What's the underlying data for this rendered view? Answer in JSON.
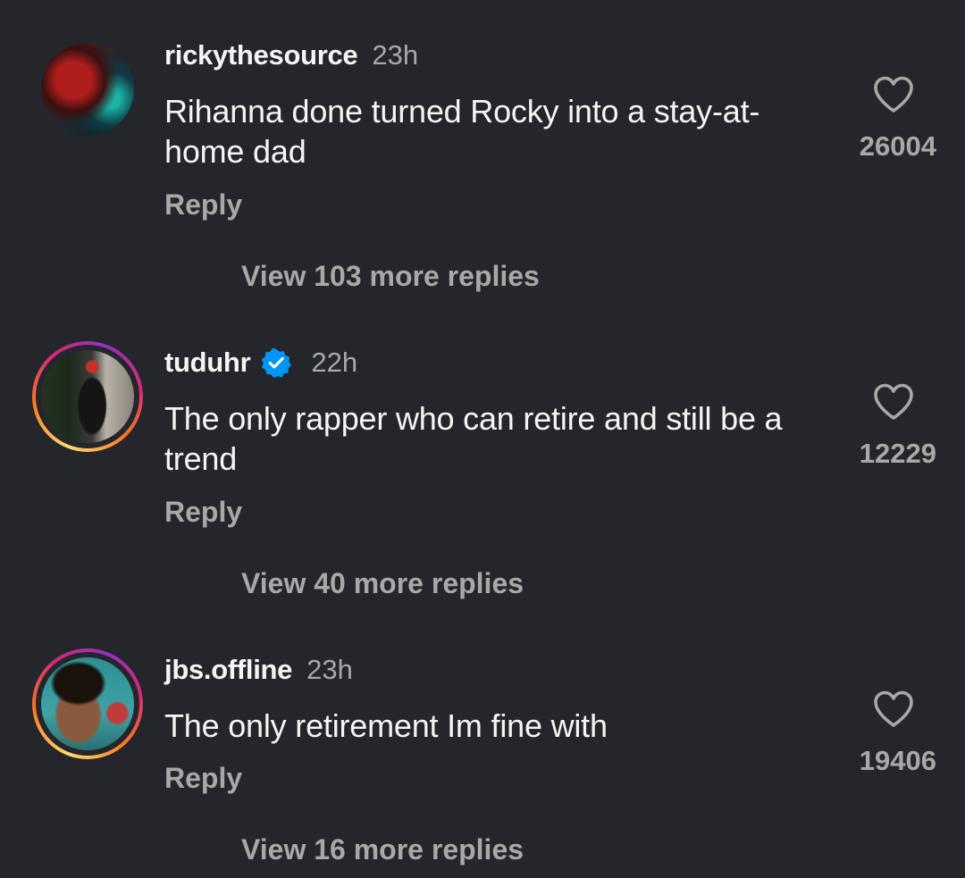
{
  "comments": [
    {
      "username": "rickythesource",
      "time": "23h",
      "verified": false,
      "text": "Rihanna done turned Rocky into a stay-at-home dad",
      "reply_label": "Reply",
      "likes": "26004",
      "view_more": "View 103 more replies"
    },
    {
      "username": "tuduhr",
      "time": "22h",
      "verified": true,
      "text": "The only rapper who can retire and still be a trend",
      "reply_label": "Reply",
      "likes": "12229",
      "view_more": "View 40 more replies"
    },
    {
      "username": "jbs.offline",
      "time": "23h",
      "verified": false,
      "text": "The only retirement Im fine with",
      "reply_label": "Reply",
      "likes": "19406",
      "view_more": "View 16 more replies"
    }
  ],
  "colors": {
    "background": "#25262b",
    "primary_text": "#f5f5f5",
    "secondary_text": "#a8a8a8",
    "verified_blue": "#0095f6"
  },
  "icons": {
    "like": "heart-outline-icon",
    "verified": "verified-badge-icon"
  }
}
